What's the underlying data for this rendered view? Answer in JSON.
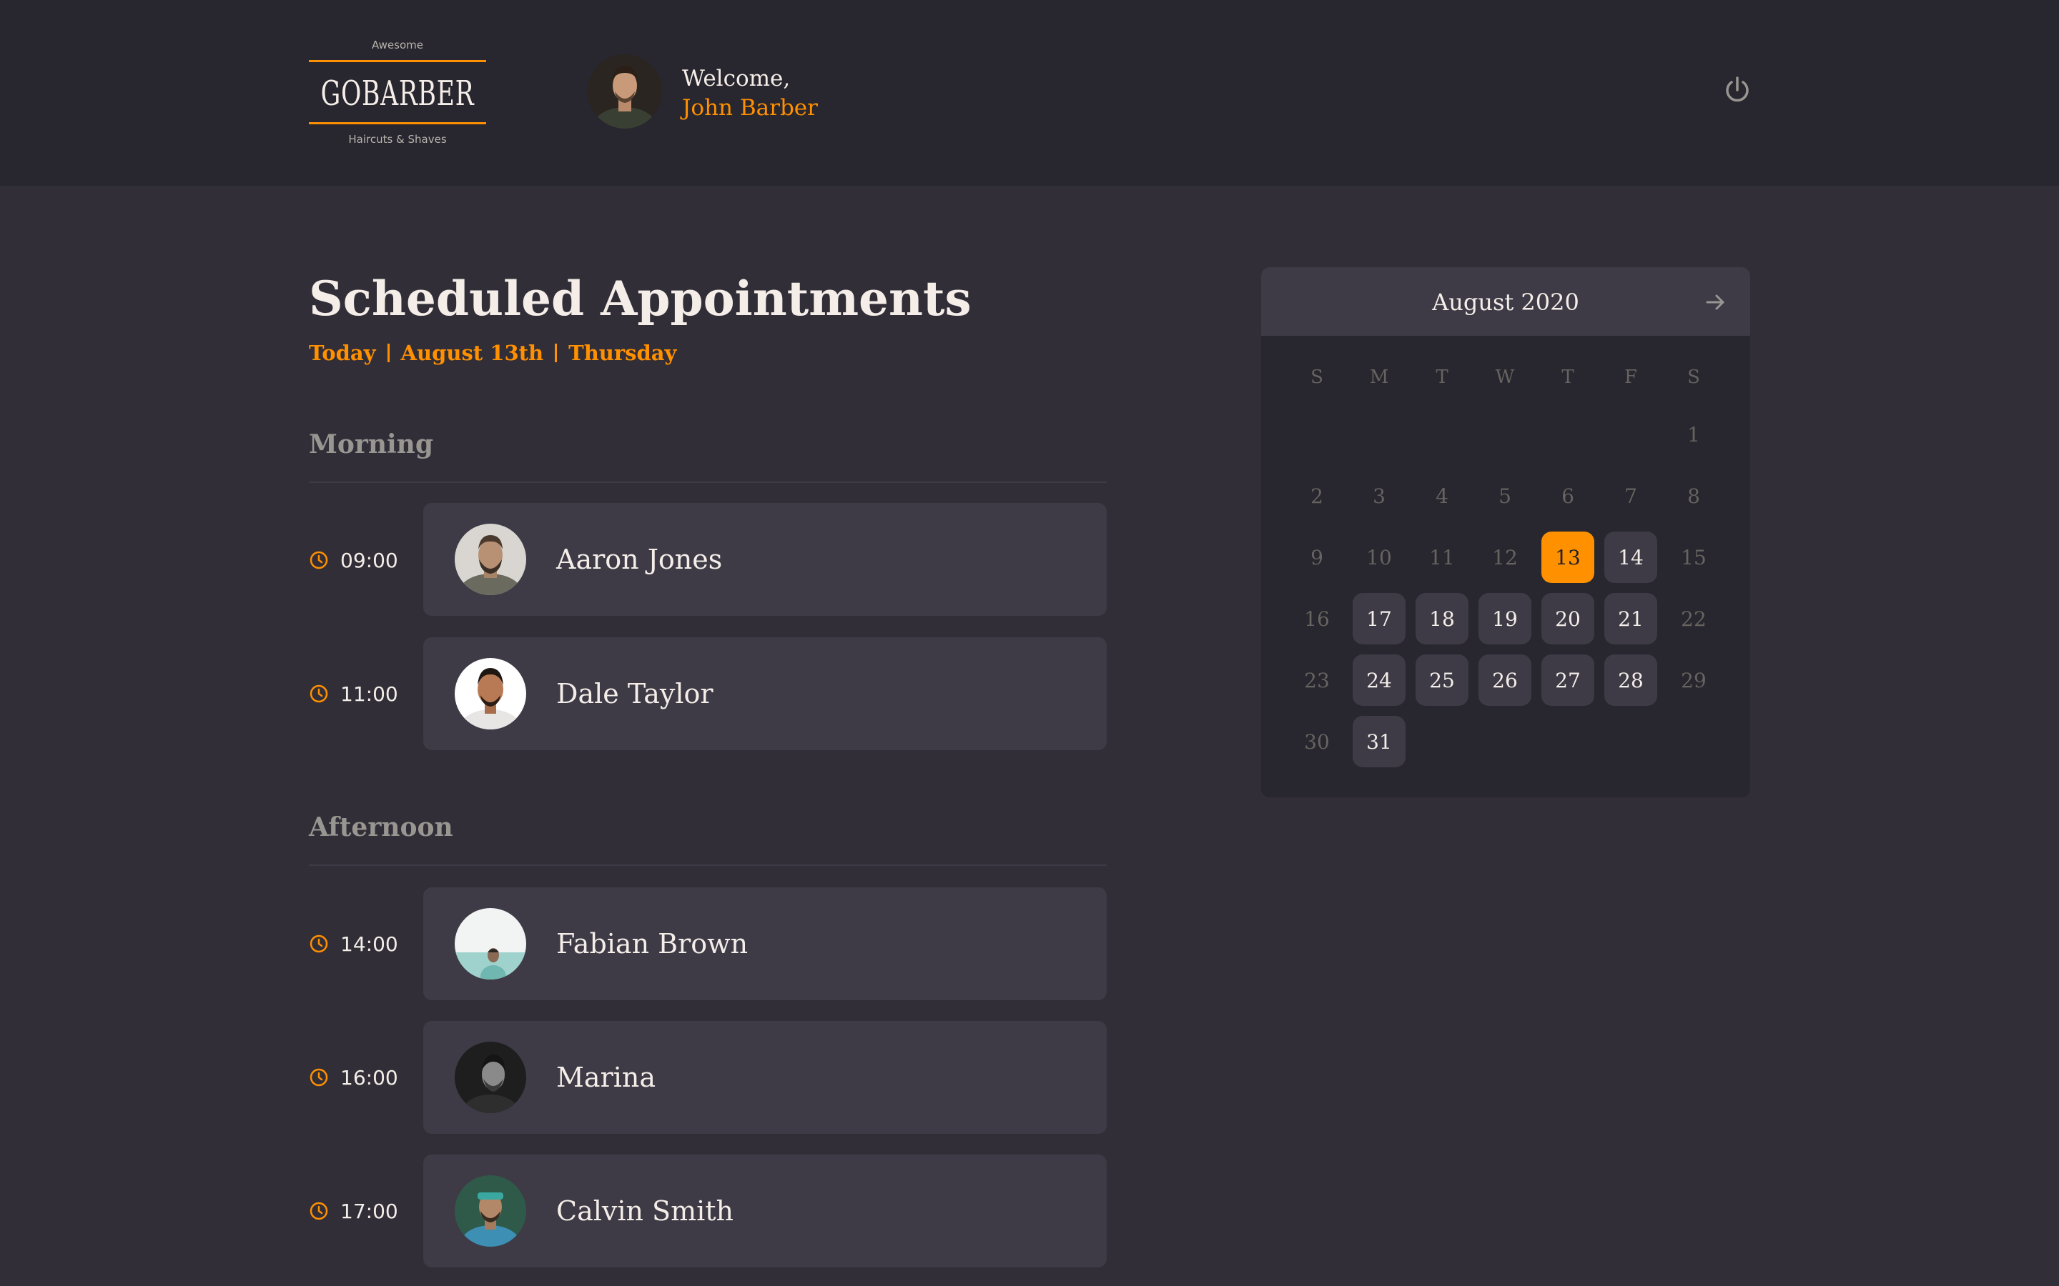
{
  "header": {
    "logo": {
      "top_text": "Awesome",
      "main_text": "GOBARBER",
      "bottom_text": "Haircuts & Shaves"
    },
    "welcome_text": "Welcome,",
    "user_name": "John Barber",
    "logout_icon": "power-icon"
  },
  "main": {
    "title": "Scheduled Appointments",
    "date_info": {
      "today": "Today",
      "date": "August 13th",
      "weekday": "Thursday"
    },
    "sections": [
      {
        "title": "Morning",
        "appointments": [
          {
            "time": "09:00",
            "name": "Aaron Jones"
          },
          {
            "time": "11:00",
            "name": "Dale Taylor"
          }
        ]
      },
      {
        "title": "Afternoon",
        "appointments": [
          {
            "time": "14:00",
            "name": "Fabian Brown"
          },
          {
            "time": "16:00",
            "name": "Marina"
          },
          {
            "time": "17:00",
            "name": "Calvin Smith"
          }
        ]
      }
    ]
  },
  "calendar": {
    "month": "August 2020",
    "next_icon": "arrow-right-icon",
    "weekdays": [
      "S",
      "M",
      "T",
      "W",
      "T",
      "F",
      "S"
    ],
    "selected_day": "13",
    "days": [
      [
        "",
        "",
        "",
        "",
        "",
        "",
        "1"
      ],
      [
        "2",
        "3",
        "4",
        "5",
        "6",
        "7",
        "8"
      ],
      [
        "9",
        "10",
        "11",
        "12",
        "13",
        "14",
        "15"
      ],
      [
        "16",
        "17",
        "18",
        "19",
        "20",
        "21",
        "22"
      ],
      [
        "23",
        "24",
        "25",
        "26",
        "27",
        "28",
        "29"
      ],
      [
        "30",
        "31",
        "",
        "",
        "",
        "",
        ""
      ]
    ],
    "available_days": [
      "14",
      "17",
      "18",
      "19",
      "20",
      "21",
      "24",
      "25",
      "26",
      "27",
      "28",
      "31"
    ]
  },
  "colors": {
    "accent": "#ff9000",
    "background": "#312e38",
    "header": "#28262e",
    "card": "#3e3b47",
    "text": "#f4ede8",
    "muted": "#999591",
    "disabled": "#666360"
  }
}
